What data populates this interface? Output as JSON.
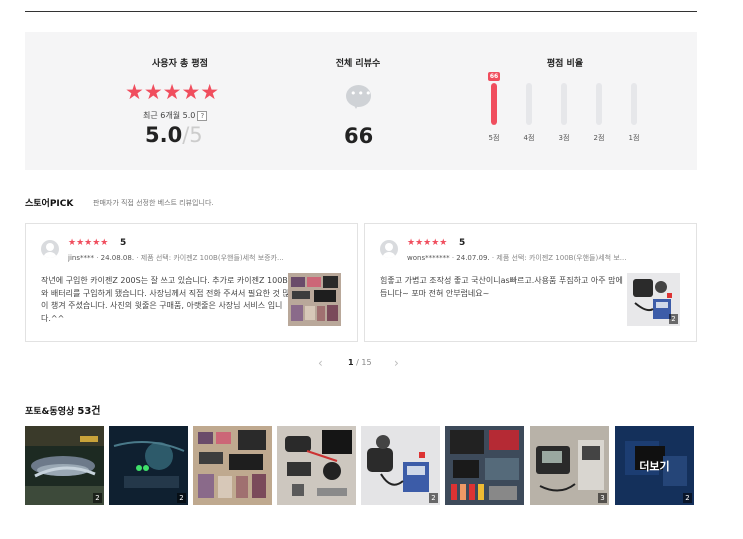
{
  "summary": {
    "user_total_rating_label": "사용자 총 평점",
    "stars": "★★★★★",
    "recent_label": "최근 6개월 5.0",
    "help_glyph": "?",
    "score": "5.0",
    "score_max": "/5",
    "total_reviews_label": "전체 리뷰수",
    "bubble_dots": "•••",
    "total_reviews": "66",
    "ratio_label": "평점 비율",
    "rating_distribution": [
      {
        "label": "5점",
        "count": 66,
        "fraction": 1.0,
        "badge": "66"
      },
      {
        "label": "4점",
        "count": 0,
        "fraction": 0.0
      },
      {
        "label": "3점",
        "count": 0,
        "fraction": 0.0
      },
      {
        "label": "2점",
        "count": 0,
        "fraction": 0.0
      },
      {
        "label": "1점",
        "count": 0,
        "fraction": 0.0
      }
    ],
    "accent_color": "#f04e5e"
  },
  "store_pick": {
    "title": "스토어PICK",
    "description": "판매자가 직접 선정한 베스트 리뷰입니다.",
    "reviews": [
      {
        "stars": "★★★★★",
        "rating": "5",
        "user": "jins****",
        "date": "24.08.08.",
        "option": "제품 선택: 카이젠Z 100B(우핸들)세척 보증카...",
        "text": "작년에 구입한 카이젠Z 200S는 잘 쓰고 있습니다. 추가로 카이젠Z 100B와 배터리를 구입하게 됐습니다. 사장님께서 직접 전화 주셔서 필요한 것 많이 챙겨 주셨습니다. 사진의 윗줄은 구매품, 아랫줄은 사장님 서비스 입니다.^^",
        "photo_count": ""
      },
      {
        "stars": "★★★★★",
        "rating": "5",
        "user": "wons*******",
        "date": "24.07.09.",
        "option": "제품 선택: 카이젠Z 100B(우핸들)세척 보...",
        "text": "힘좋고 가볍고 조작성 좋고 국산이니as빠르고.사용품 푸짐하고 아주 맘에 듭니다~ 포마 전혀 안부럽네요~",
        "photo_count": "2"
      }
    ],
    "pager": {
      "prev": "‹",
      "current": "1",
      "total": "/ 15",
      "next": "›"
    }
  },
  "photos": {
    "title": "포토&동영상",
    "count": "53건",
    "items": [
      {
        "count": "2"
      },
      {
        "count": "2"
      },
      {
        "count": ""
      },
      {
        "count": ""
      },
      {
        "count": "2"
      },
      {
        "count": ""
      },
      {
        "count": "3"
      },
      {
        "count": "2",
        "more_label": "더보기"
      }
    ]
  }
}
